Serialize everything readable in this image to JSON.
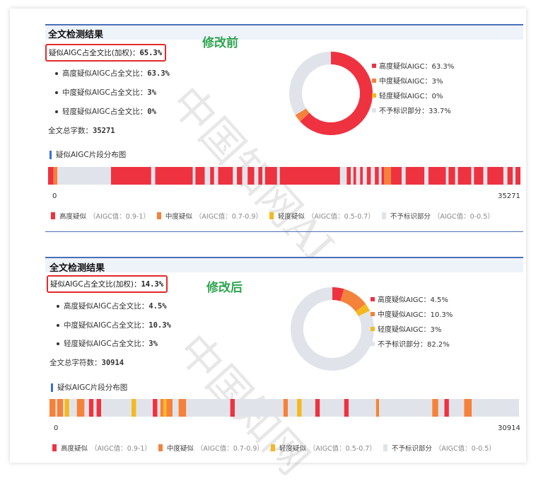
{
  "colors": {
    "high": "#ee3240",
    "medium": "#f5823a",
    "light": "#f6b820",
    "none": "#e0e4ea"
  },
  "top": {
    "title": "全文检测结果",
    "overall_label": "疑似AIGC占全文比(加权)：",
    "overall_value": "65.3%",
    "note": "修改前",
    "subs": [
      {
        "label": "高度疑似AIGC占全文比：",
        "value": "63.3%"
      },
      {
        "label": "中度疑似AIGC占全文比：",
        "value": "3%"
      },
      {
        "label": "轻度疑似AIGC占全文比：",
        "value": "0%"
      }
    ],
    "total_label": "全文总字数：",
    "total_value": "35271",
    "legend": [
      "高度疑似AIGC：63.3%",
      "中度疑似AIGC：3%",
      "轻度疑似AIGC：0%",
      "不予标识部分：33.7%"
    ],
    "seg_title": "疑似AIGC片段分布图",
    "axis_start": "0",
    "axis_end": "35271"
  },
  "bottom": {
    "title": "全文检测结果",
    "overall_label": "疑似AIGC占全文比(加权)：",
    "overall_value": "14.3%",
    "note": "修改后",
    "subs": [
      {
        "label": "高度疑似AIGC占全文比：",
        "value": "4.5%"
      },
      {
        "label": "中度疑似AIGC占全文比：",
        "value": "10.3%"
      },
      {
        "label": "轻度疑似AIGC占全文比：",
        "value": "3%"
      }
    ],
    "total_label": "全文总字符数：",
    "total_value": "30914",
    "legend": [
      "高度疑似AIGC：4.5%",
      "中度疑似AIGC：10.3%",
      "轻度疑似AIGC：3%",
      "不予标识部分：82.2%"
    ],
    "seg_title": "疑似AIGC片段分布图",
    "axis_start": "0",
    "axis_end": "30914"
  },
  "bottom_legend": {
    "high": "高度疑似",
    "high_range": "（AIGC值：0.9-1）",
    "medium": "中度疑似",
    "medium_range": "（AIGC值：0.7-0.9）",
    "light": "轻度疑似",
    "light_range": "（AIGC值：0.5-0.7）",
    "none": "不予标识部分",
    "none_range": "（AIGC值：0-0.5）"
  },
  "watermark": "中国知网",
  "chart_data": [
    {
      "type": "pie",
      "categories": [
        "高度疑似AIGC",
        "中度疑似AIGC",
        "轻度疑似AIGC",
        "不予标识部分"
      ],
      "values": [
        63.3,
        3,
        0,
        33.7
      ],
      "colors": [
        "#ee3240",
        "#f5823a",
        "#f6b820",
        "#e0e4ea"
      ],
      "legend": "right"
    },
    {
      "type": "bar",
      "x_max": 35271,
      "segments": [
        {
          "start": 0,
          "end": 400,
          "level": "high"
        },
        {
          "start": 400,
          "end": 700,
          "level": "medium"
        },
        {
          "start": 700,
          "end": 4700,
          "level": "none"
        },
        {
          "start": 4700,
          "end": 7700,
          "level": "high"
        },
        {
          "start": 7700,
          "end": 8000,
          "level": "none"
        },
        {
          "start": 8000,
          "end": 10800,
          "level": "high"
        },
        {
          "start": 10800,
          "end": 11000,
          "level": "none"
        },
        {
          "start": 11000,
          "end": 11700,
          "level": "high"
        },
        {
          "start": 11700,
          "end": 12100,
          "level": "none"
        },
        {
          "start": 12100,
          "end": 12400,
          "level": "high"
        },
        {
          "start": 12400,
          "end": 12700,
          "level": "none"
        },
        {
          "start": 12700,
          "end": 13800,
          "level": "high"
        },
        {
          "start": 13800,
          "end": 14100,
          "level": "none"
        },
        {
          "start": 14100,
          "end": 14500,
          "level": "high"
        },
        {
          "start": 14500,
          "end": 14900,
          "level": "none"
        },
        {
          "start": 14900,
          "end": 15400,
          "level": "high"
        },
        {
          "start": 15400,
          "end": 15700,
          "level": "none"
        },
        {
          "start": 15700,
          "end": 16000,
          "level": "high"
        },
        {
          "start": 16000,
          "end": 16200,
          "level": "none"
        },
        {
          "start": 16200,
          "end": 17100,
          "level": "high"
        },
        {
          "start": 17100,
          "end": 17300,
          "level": "none"
        },
        {
          "start": 17300,
          "end": 21800,
          "level": "high"
        },
        {
          "start": 21800,
          "end": 22300,
          "level": "none"
        },
        {
          "start": 22300,
          "end": 22600,
          "level": "high"
        },
        {
          "start": 22600,
          "end": 22800,
          "level": "none"
        },
        {
          "start": 22800,
          "end": 23000,
          "level": "high"
        },
        {
          "start": 23000,
          "end": 23300,
          "level": "none"
        },
        {
          "start": 23300,
          "end": 23500,
          "level": "high"
        },
        {
          "start": 23500,
          "end": 23800,
          "level": "none"
        },
        {
          "start": 23800,
          "end": 24100,
          "level": "high"
        },
        {
          "start": 24100,
          "end": 24400,
          "level": "none"
        },
        {
          "start": 24400,
          "end": 24700,
          "level": "high"
        },
        {
          "start": 24700,
          "end": 24900,
          "level": "none"
        },
        {
          "start": 24900,
          "end": 25100,
          "level": "high"
        },
        {
          "start": 25100,
          "end": 25600,
          "level": "medium"
        },
        {
          "start": 25600,
          "end": 26400,
          "level": "high"
        },
        {
          "start": 26400,
          "end": 26700,
          "level": "none"
        },
        {
          "start": 26700,
          "end": 28100,
          "level": "high"
        },
        {
          "start": 28100,
          "end": 28400,
          "level": "none"
        },
        {
          "start": 28400,
          "end": 29700,
          "level": "high"
        },
        {
          "start": 29700,
          "end": 29900,
          "level": "none"
        },
        {
          "start": 29900,
          "end": 30400,
          "level": "high"
        },
        {
          "start": 30400,
          "end": 30600,
          "level": "none"
        },
        {
          "start": 30600,
          "end": 31600,
          "level": "high"
        },
        {
          "start": 31600,
          "end": 31800,
          "level": "none"
        },
        {
          "start": 31800,
          "end": 32500,
          "level": "high"
        },
        {
          "start": 32500,
          "end": 32800,
          "level": "none"
        },
        {
          "start": 32800,
          "end": 34000,
          "level": "high"
        },
        {
          "start": 34000,
          "end": 34300,
          "level": "none"
        },
        {
          "start": 34300,
          "end": 34700,
          "level": "high"
        },
        {
          "start": 34700,
          "end": 34900,
          "level": "none"
        },
        {
          "start": 34900,
          "end": 35271,
          "level": "high"
        }
      ]
    },
    {
      "type": "pie",
      "categories": [
        "高度疑似AIGC",
        "中度疑似AIGC",
        "轻度疑似AIGC",
        "不予标识部分"
      ],
      "values": [
        4.5,
        10.3,
        3,
        82.2
      ],
      "colors": [
        "#ee3240",
        "#f5823a",
        "#f6b820",
        "#e0e4ea"
      ],
      "legend": "right"
    },
    {
      "type": "bar",
      "x_max": 30914,
      "segments": [
        {
          "start": 0,
          "end": 400,
          "level": "medium"
        },
        {
          "start": 400,
          "end": 500,
          "level": "none"
        },
        {
          "start": 500,
          "end": 900,
          "level": "medium"
        },
        {
          "start": 900,
          "end": 1000,
          "level": "none"
        },
        {
          "start": 1000,
          "end": 1300,
          "level": "light"
        },
        {
          "start": 1300,
          "end": 1800,
          "level": "none"
        },
        {
          "start": 1800,
          "end": 2300,
          "level": "medium"
        },
        {
          "start": 2300,
          "end": 2600,
          "level": "none"
        },
        {
          "start": 2600,
          "end": 2900,
          "level": "high"
        },
        {
          "start": 2900,
          "end": 3100,
          "level": "none"
        },
        {
          "start": 3100,
          "end": 3400,
          "level": "high"
        },
        {
          "start": 3400,
          "end": 5400,
          "level": "none"
        },
        {
          "start": 5400,
          "end": 5700,
          "level": "light"
        },
        {
          "start": 5700,
          "end": 6800,
          "level": "none"
        },
        {
          "start": 6800,
          "end": 7100,
          "level": "high"
        },
        {
          "start": 7100,
          "end": 7300,
          "level": "none"
        },
        {
          "start": 7300,
          "end": 7500,
          "level": "medium"
        },
        {
          "start": 7500,
          "end": 7700,
          "level": "light"
        },
        {
          "start": 7700,
          "end": 8100,
          "level": "medium"
        },
        {
          "start": 8100,
          "end": 8500,
          "level": "none"
        },
        {
          "start": 8500,
          "end": 9000,
          "level": "medium"
        },
        {
          "start": 9000,
          "end": 11900,
          "level": "none"
        },
        {
          "start": 11900,
          "end": 12200,
          "level": "high"
        },
        {
          "start": 12200,
          "end": 15400,
          "level": "none"
        },
        {
          "start": 15400,
          "end": 15700,
          "level": "medium"
        },
        {
          "start": 15700,
          "end": 16300,
          "level": "none"
        },
        {
          "start": 16300,
          "end": 16600,
          "level": "light"
        },
        {
          "start": 16600,
          "end": 17500,
          "level": "none"
        },
        {
          "start": 17500,
          "end": 17800,
          "level": "high"
        },
        {
          "start": 17800,
          "end": 19400,
          "level": "none"
        },
        {
          "start": 19400,
          "end": 19700,
          "level": "high"
        },
        {
          "start": 19700,
          "end": 21500,
          "level": "none"
        },
        {
          "start": 21500,
          "end": 21700,
          "level": "medium"
        },
        {
          "start": 21700,
          "end": 25200,
          "level": "none"
        },
        {
          "start": 25200,
          "end": 25600,
          "level": "medium"
        },
        {
          "start": 25600,
          "end": 26000,
          "level": "none"
        },
        {
          "start": 26000,
          "end": 26300,
          "level": "high"
        },
        {
          "start": 26300,
          "end": 27300,
          "level": "none"
        },
        {
          "start": 27300,
          "end": 27800,
          "level": "medium"
        },
        {
          "start": 27800,
          "end": 30914,
          "level": "none"
        }
      ]
    }
  ]
}
